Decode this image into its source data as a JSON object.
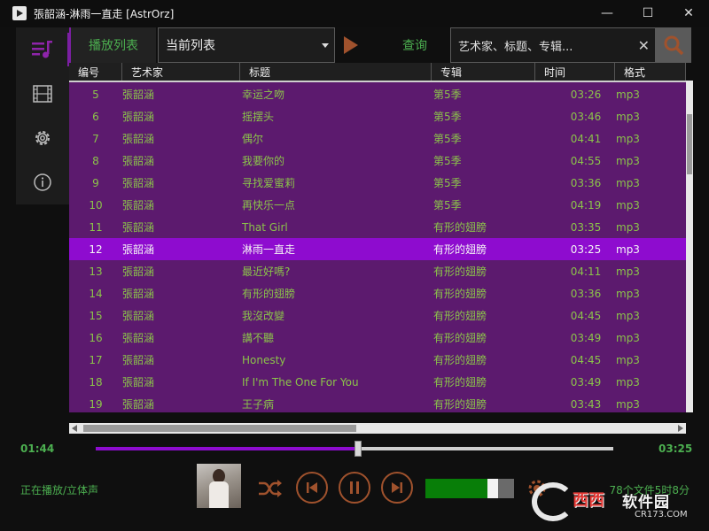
{
  "window": {
    "title": "張韶涵-淋雨一直走 [AstrOrz]",
    "minimize": "—",
    "maximize": "☐",
    "close": "✕"
  },
  "sidebar": {
    "items": [
      {
        "name": "playlist",
        "icon": "playlist-music-icon",
        "active": true
      },
      {
        "name": "video",
        "icon": "film-icon",
        "active": false
      },
      {
        "name": "settings",
        "icon": "gear-icon",
        "active": false
      },
      {
        "name": "about",
        "icon": "info-icon",
        "active": false
      }
    ]
  },
  "toolbar": {
    "playlist_tab": "播放列表",
    "list_select_value": "当前列表",
    "query_label": "查询",
    "search_placeholder": "艺术家、标题、专辑...",
    "clear_glyph": "✕"
  },
  "table": {
    "headers": [
      "编号",
      "艺术家",
      "标题",
      "专辑",
      "时间",
      "格式"
    ],
    "selected_index": 7,
    "rows": [
      {
        "num": "5",
        "artist": "張韶涵",
        "title": "幸运之吻",
        "album": "第5季",
        "time": "03:26",
        "format": "mp3"
      },
      {
        "num": "6",
        "artist": "張韶涵",
        "title": "摇摆头",
        "album": "第5季",
        "time": "03:46",
        "format": "mp3"
      },
      {
        "num": "7",
        "artist": "張韶涵",
        "title": "偶尔",
        "album": "第5季",
        "time": "04:41",
        "format": "mp3"
      },
      {
        "num": "8",
        "artist": "張韶涵",
        "title": "我要你的",
        "album": "第5季",
        "time": "04:55",
        "format": "mp3"
      },
      {
        "num": "9",
        "artist": "張韶涵",
        "title": "寻找爱蜜莉",
        "album": "第5季",
        "time": "03:36",
        "format": "mp3"
      },
      {
        "num": "10",
        "artist": "張韶涵",
        "title": "再快乐一点",
        "album": "第5季",
        "time": "04:19",
        "format": "mp3"
      },
      {
        "num": "11",
        "artist": "張韶涵",
        "title": "That Girl",
        "album": "有形的翅膀",
        "time": "03:35",
        "format": "mp3"
      },
      {
        "num": "12",
        "artist": "張韶涵",
        "title": "淋雨一直走",
        "album": "有形的翅膀",
        "time": "03:25",
        "format": "mp3"
      },
      {
        "num": "13",
        "artist": "張韶涵",
        "title": "最近好嗎?",
        "album": "有形的翅膀",
        "time": "04:11",
        "format": "mp3"
      },
      {
        "num": "14",
        "artist": "張韶涵",
        "title": "有形的翅膀",
        "album": "有形的翅膀",
        "time": "03:36",
        "format": "mp3"
      },
      {
        "num": "15",
        "artist": "張韶涵",
        "title": "我沒改變",
        "album": "有形的翅膀",
        "time": "04:45",
        "format": "mp3"
      },
      {
        "num": "16",
        "artist": "張韶涵",
        "title": "講不聽",
        "album": "有形的翅膀",
        "time": "03:49",
        "format": "mp3"
      },
      {
        "num": "17",
        "artist": "張韶涵",
        "title": "Honesty",
        "album": "有形的翅膀",
        "time": "04:45",
        "format": "mp3"
      },
      {
        "num": "18",
        "artist": "張韶涵",
        "title": "If I'm The One For You",
        "album": "有形的翅膀",
        "time": "03:49",
        "format": "mp3"
      },
      {
        "num": "19",
        "artist": "張韶涵",
        "title": "王子病",
        "album": "有形的翅膀",
        "time": "03:43",
        "format": "mp3"
      }
    ]
  },
  "player": {
    "current_time": "01:44",
    "total_time": "03:25",
    "progress_fraction": 0.507,
    "status": "正在播放/立体声",
    "volume_fraction": 0.76,
    "file_count": "78个文件5时8分"
  },
  "watermark": {
    "cn": "西西",
    "soft": "软件园",
    "url": "CR173.COM"
  },
  "colors": {
    "accent_purple": "#8e0ccf",
    "table_bg": "#5c1a6e",
    "text_green": "#8bc34a",
    "control_orange": "#a0522d"
  }
}
